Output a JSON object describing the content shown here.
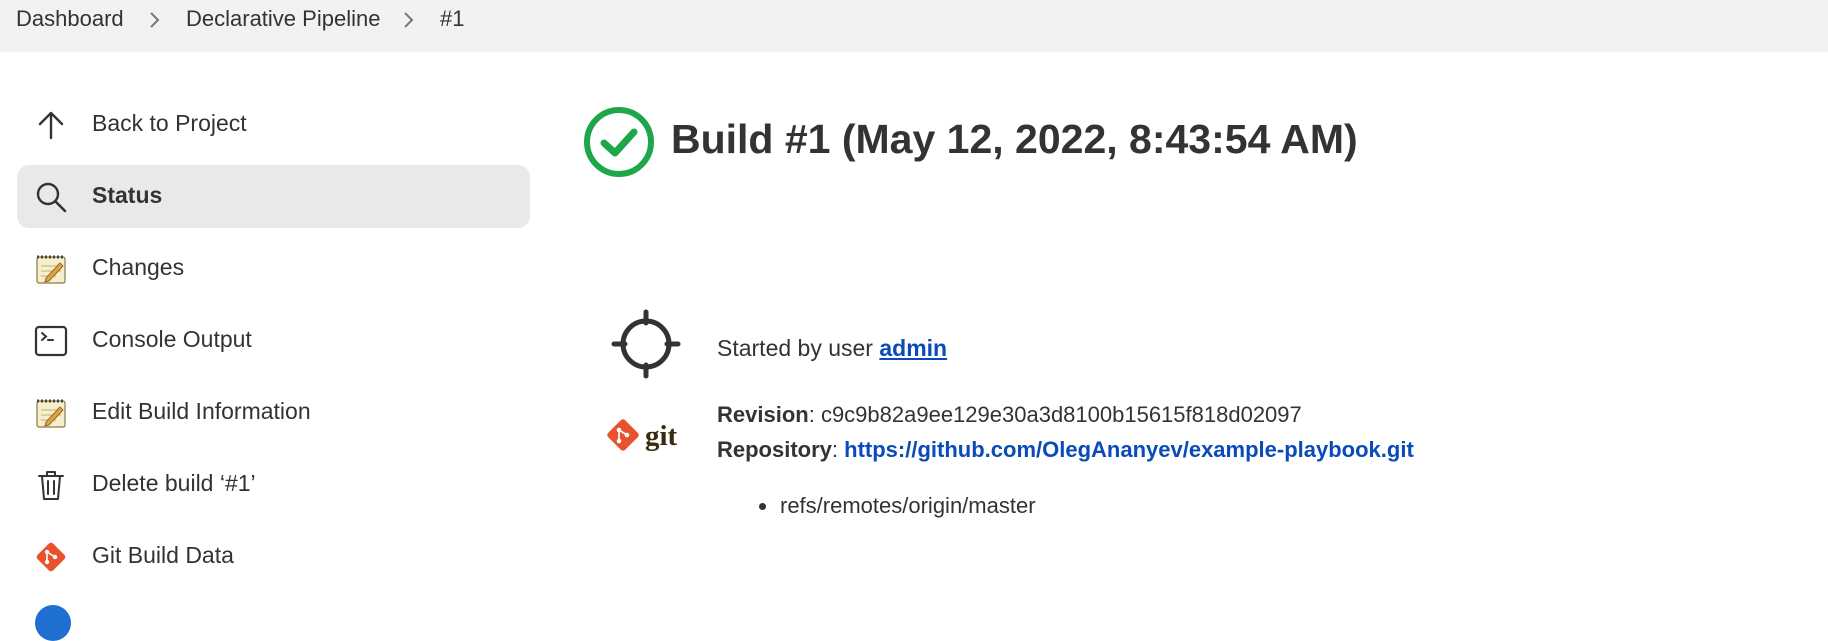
{
  "breadcrumb": {
    "items": [
      "Dashboard",
      "Declarative Pipeline",
      "#1"
    ]
  },
  "sidebar": {
    "items": [
      {
        "label": "Back to Project",
        "icon": "arrow-up-icon"
      },
      {
        "label": "Status",
        "icon": "search-icon",
        "active": true
      },
      {
        "label": "Changes",
        "icon": "notepad-icon"
      },
      {
        "label": "Console Output",
        "icon": "terminal-icon"
      },
      {
        "label": "Edit Build Information",
        "icon": "notepad-icon"
      },
      {
        "label": "Delete build ‘#1’",
        "icon": "trash-icon"
      },
      {
        "label": "Git Build Data",
        "icon": "git-icon"
      }
    ]
  },
  "build": {
    "title": "Build #1 (May 12, 2022, 8:43:54 AM)",
    "status_icon": "success-check-icon",
    "status_color": "#1ea64b",
    "started_by_prefix": "Started by user",
    "started_by_user": "admin",
    "revision_label": "Revision",
    "revision": "c9c9b82a9ee129e30a3d8100b15615f818d02097",
    "repository_label": "Repository",
    "repository": "https://github.com/OlegAnanyev/example-playbook.git",
    "branches": [
      "refs/remotes/origin/master"
    ]
  },
  "colors": {
    "accent_link": "#0a4bb8",
    "git_orange": "#e8532e",
    "success_green": "#1ea64b"
  }
}
